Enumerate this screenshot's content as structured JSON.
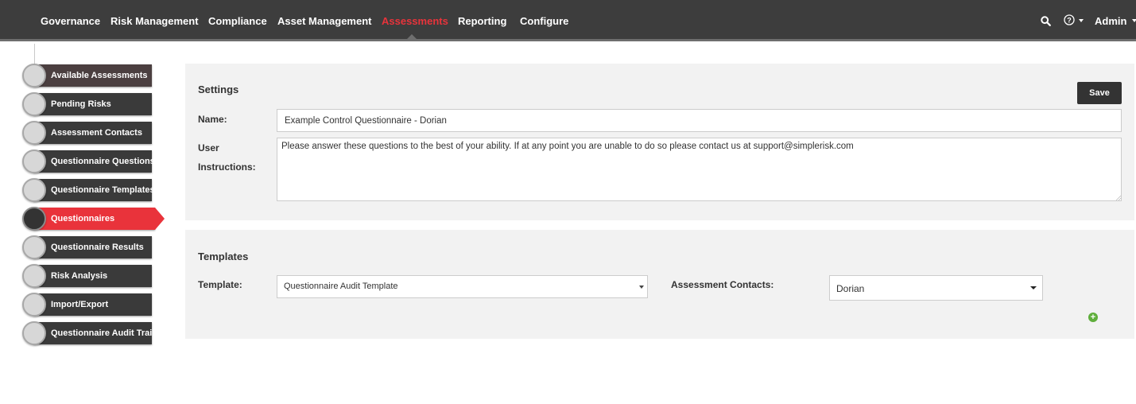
{
  "nav": {
    "items": [
      {
        "label": "Governance"
      },
      {
        "label": "Risk Management"
      },
      {
        "label": "Compliance"
      },
      {
        "label": "Asset Management"
      },
      {
        "label": "Assessments",
        "active": true
      },
      {
        "label": "Reporting"
      },
      {
        "label": "Configure"
      }
    ],
    "search_icon": "search-icon",
    "help_icon": "help-icon",
    "user_label": "Admin"
  },
  "sidebar": {
    "items": [
      {
        "label": "Available Assessments"
      },
      {
        "label": "Pending Risks"
      },
      {
        "label": "Assessment Contacts"
      },
      {
        "label": "Questionnaire Questions"
      },
      {
        "label": "Questionnaire Templates"
      },
      {
        "label": "Questionnaires",
        "active": true
      },
      {
        "label": "Questionnaire Results"
      },
      {
        "label": "Risk Analysis"
      },
      {
        "label": "Import/Export"
      },
      {
        "label": "Questionnaire Audit Trail"
      }
    ]
  },
  "settings": {
    "title": "Settings",
    "save_label": "Save",
    "name_label": "Name:",
    "name_value": "Example Control Questionnaire - Dorian",
    "instructions_label_line1": "User",
    "instructions_label_line2": "Instructions:",
    "instructions_value": "Please answer these questions to the best of your ability. If at any point you are unable to do so please contact us at support@simplerisk.com"
  },
  "templates": {
    "title": "Templates",
    "template_label": "Template:",
    "template_value": "Questionnaire Audit Template",
    "contacts_label": "Assessment Contacts:",
    "contacts_value": "Dorian",
    "add_icon": "plus-circle-icon"
  },
  "colors": {
    "accent": "#e9333b",
    "navbar": "#3d3d3d",
    "sidebar_item": "#3a3a3a",
    "panel": "#f2f2f2",
    "add_green": "#5fae3c"
  }
}
